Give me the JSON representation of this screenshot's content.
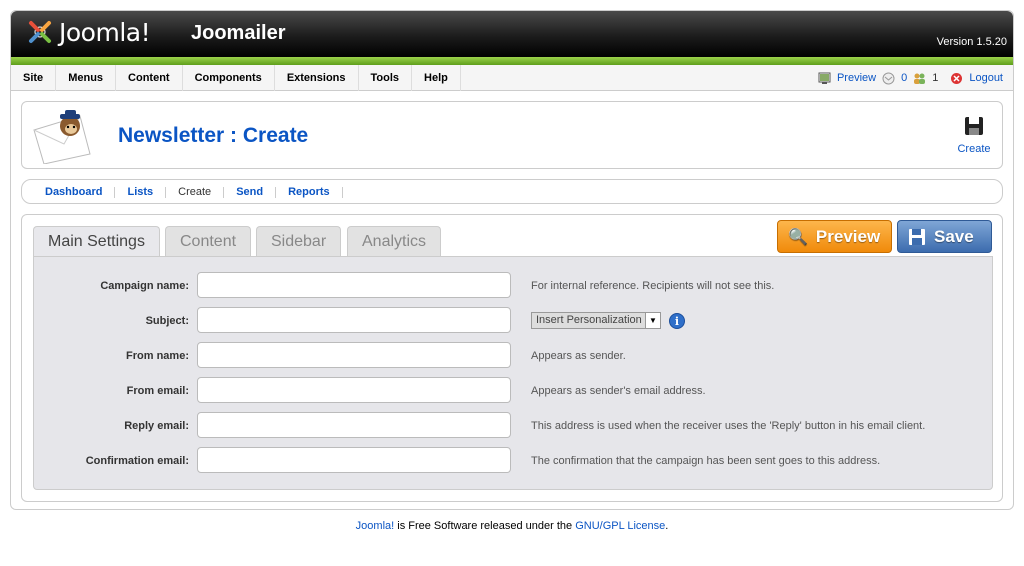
{
  "header": {
    "logo_text": "Joomla!",
    "app_title": "Joomailer",
    "version": "Version 1.5.20"
  },
  "menu": [
    {
      "label": "Site"
    },
    {
      "label": "Menus"
    },
    {
      "label": "Content"
    },
    {
      "label": "Components"
    },
    {
      "label": "Extensions"
    },
    {
      "label": "Tools"
    },
    {
      "label": "Help"
    }
  ],
  "status": {
    "preview": "Preview",
    "messages": "0",
    "users": "1",
    "logout": "Logout"
  },
  "toolbar": {
    "title": "Newsletter : Create",
    "create": "Create"
  },
  "submenu": [
    {
      "label": "Dashboard"
    },
    {
      "label": "Lists"
    },
    {
      "label": "Create"
    },
    {
      "label": "Send"
    },
    {
      "label": "Reports"
    }
  ],
  "tabs": [
    {
      "label": "Main Settings"
    },
    {
      "label": "Content"
    },
    {
      "label": "Sidebar"
    },
    {
      "label": "Analytics"
    }
  ],
  "buttons": {
    "preview": "Preview",
    "save": "Save"
  },
  "form": {
    "rows": [
      {
        "label": "Campaign name:",
        "value": "",
        "help": "For internal reference. Recipients will not see this."
      },
      {
        "label": "Subject:",
        "value": "",
        "help": ""
      },
      {
        "label": "From name:",
        "value": "",
        "help": "Appears as sender."
      },
      {
        "label": "From email:",
        "value": "",
        "help": "Appears as sender's email address."
      },
      {
        "label": "Reply email:",
        "value": "",
        "help": "This address is used when the receiver uses the 'Reply' button in his email client."
      },
      {
        "label": "Confirmation email:",
        "value": "",
        "help": "The confirmation that the campaign has been sent goes to this address."
      }
    ],
    "personalization": "Insert Personalization"
  },
  "footer": {
    "link1": "Joomla!",
    "text": " is Free Software released under the ",
    "link2": "GNU/GPL License",
    "end": "."
  },
  "colors": {
    "link": "#0b55c4",
    "menu_accent": "#5e9e1c",
    "preview_button": "#f08a0a",
    "save_button": "#3c6cae"
  }
}
